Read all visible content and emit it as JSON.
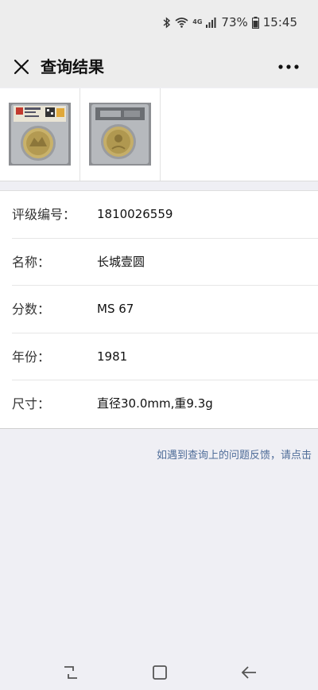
{
  "status_bar": {
    "network": "4G",
    "battery": "73%",
    "time": "15:45"
  },
  "header": {
    "title": "查询结果"
  },
  "thumbnails": [
    {
      "icon": "coin-slab-front-image"
    },
    {
      "icon": "coin-slab-back-image"
    }
  ],
  "details": [
    {
      "label": "评级编号：",
      "value": "1810026559"
    },
    {
      "label": "名称：",
      "value": "长城壹圆"
    },
    {
      "label": "分数：",
      "value": "MS 67"
    },
    {
      "label": "年份：",
      "value": "1981"
    },
    {
      "label": "尺寸：",
      "value": "直径30.0mm,重9.3g"
    }
  ],
  "feedback": {
    "text": "如遇到查询上的问题反馈，请点击"
  }
}
